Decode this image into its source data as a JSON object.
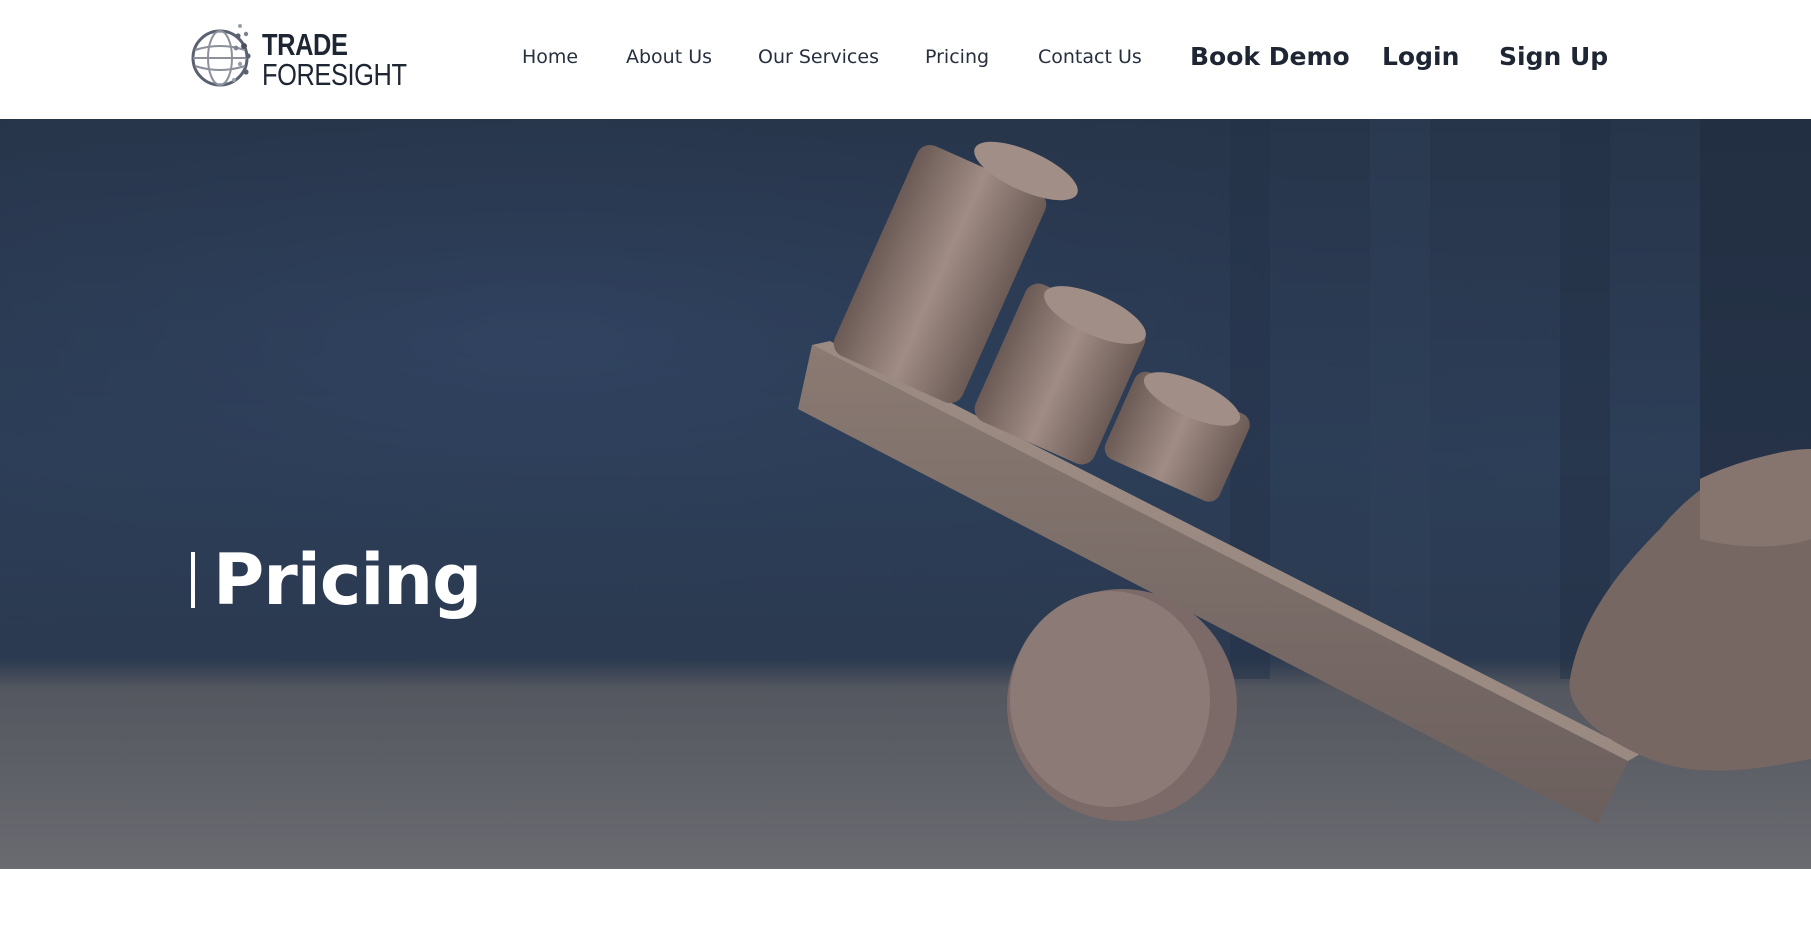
{
  "brand": {
    "name_line1": "TRADE",
    "name_line2": "FORESIGHT",
    "logo_icon": "globe-network-icon"
  },
  "nav": {
    "items": [
      {
        "label": "Home"
      },
      {
        "label": "About Us"
      },
      {
        "label": "Our Services"
      },
      {
        "label": "Pricing"
      },
      {
        "label": "Contact Us"
      }
    ],
    "book_demo": "Book Demo",
    "login": "Login",
    "sign_up": "Sign Up"
  },
  "hero": {
    "title": "Pricing",
    "image": "coins-on-seesaw-photo"
  },
  "colors": {
    "header_bg": "#ffffff",
    "nav_text": "#27303f",
    "hero_overlay": "#2d3e58",
    "hero_title": "#ffffff"
  }
}
